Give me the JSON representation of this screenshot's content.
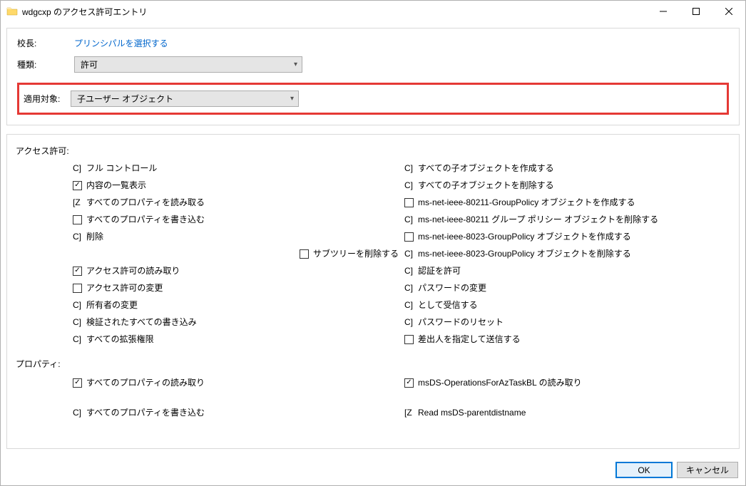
{
  "title": "wdgcxp のアクセス許可エントリ",
  "labels": {
    "principal": "校長:",
    "type": "種類:",
    "applies": "適用対象:",
    "perms": "アクセス許可:",
    "props": "プロパティ:"
  },
  "principal_link": "プリンシパルを選択する",
  "type_value": "許可",
  "applies_value": "子ユーザー オブジェクト",
  "buttons": {
    "ok": "OK",
    "cancel": "キャンセル"
  },
  "perm_left": [
    {
      "prefix": "C]",
      "label": "フル コントロール"
    },
    {
      "box": true,
      "checked": true,
      "label": "内容の一覧表示"
    },
    {
      "prefix": "[Z",
      "label": "すべてのプロパティを読み取る"
    },
    {
      "box": true,
      "checked": false,
      "label": "すべてのプロパティを書き込む"
    },
    {
      "prefix": "C]",
      "label": "削除"
    },
    {
      "box": true,
      "checked": false,
      "label": "サブツリーを削除する"
    },
    {
      "box": true,
      "checked": true,
      "label": "アクセス許可の読み取り"
    },
    {
      "box": true,
      "checked": false,
      "label": "アクセス許可の変更"
    },
    {
      "prefix": "C]",
      "label": "所有者の変更"
    },
    {
      "prefix": "C]",
      "label": "検証されたすべての書き込み"
    },
    {
      "prefix": "C]",
      "label": "すべての拡張権限"
    }
  ],
  "perm_right": [
    {
      "prefix": "C]",
      "label": "すべての子オブジェクトを作成する"
    },
    {
      "prefix": "C]",
      "label": "すべての子オブジェクトを削除する"
    },
    {
      "box": true,
      "checked": false,
      "label": "ms-net-ieee-80211-GroupPolicy オブジェクトを作成する"
    },
    {
      "prefix": "C]",
      "label": "ms-net-ieee-80211 グループ ポリシー オブジェクトを削除する"
    },
    {
      "box": true,
      "checked": false,
      "label": "ms-net-ieee-8023-GroupPolicy オブジェクトを作成する"
    },
    {
      "prefix": "C]",
      "label": "ms-net-ieee-8023-GroupPolicy オブジェクトを削除する"
    },
    {
      "prefix": "C]",
      "label": "認証を許可"
    },
    {
      "prefix": "C]",
      "label": "パスワードの変更"
    },
    {
      "prefix": "C]",
      "label": "として受信する"
    },
    {
      "prefix": "C]",
      "label": "パスワードのリセット"
    },
    {
      "box": true,
      "checked": false,
      "label": "差出人を指定して送信する"
    }
  ],
  "props_left": [
    {
      "box": true,
      "checked": true,
      "label": "すべてのプロパティの読み取り"
    },
    {
      "prefix": "C]",
      "label": "すべてのプロパティを書き込む"
    }
  ],
  "props_right": [
    {
      "box": true,
      "checked": true,
      "label": "msDS-OperationsForAzTaskBL の読み取り"
    },
    {
      "prefix": "[Z",
      "label": "Read msDS-parentdistname"
    }
  ]
}
